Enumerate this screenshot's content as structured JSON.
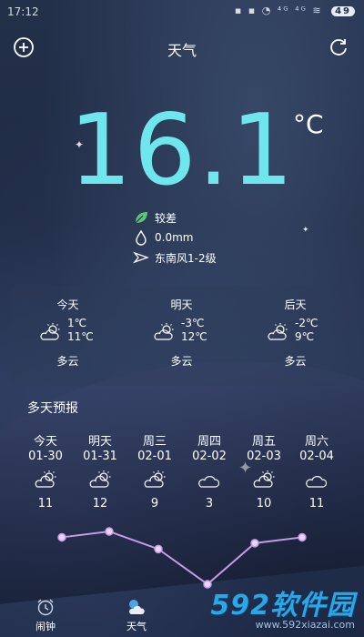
{
  "status_bar": {
    "time": "17:12",
    "icons_text": "▪ ▪ ◔ ⁴ᴳ ⁴ᴳ ≋",
    "battery": "49"
  },
  "header": {
    "title": "天气"
  },
  "current": {
    "temperature": "16.1",
    "unit": "°C",
    "air_quality": "较差",
    "precipitation": "0.0mm",
    "wind": "东南风1-2级"
  },
  "daily_summary": [
    {
      "label": "今天",
      "low": "1℃",
      "high": "11℃",
      "desc": "多云"
    },
    {
      "label": "明天",
      "low": "-3℃",
      "high": "12℃",
      "desc": "多云"
    },
    {
      "label": "后天",
      "low": "-2℃",
      "high": "9℃",
      "desc": "多云"
    }
  ],
  "forecast": {
    "title": "多天预报",
    "days": [
      {
        "name": "今天",
        "date": "01-30",
        "temp": "11",
        "icon": "sun-cloud-icon"
      },
      {
        "name": "明天",
        "date": "01-31",
        "temp": "12",
        "icon": "sun-cloud-icon"
      },
      {
        "name": "周三",
        "date": "02-01",
        "temp": "9",
        "icon": "sun-cloud-icon"
      },
      {
        "name": "周四",
        "date": "02-02",
        "temp": "3",
        "icon": "cloud-icon"
      },
      {
        "name": "周五",
        "date": "02-03",
        "temp": "10",
        "icon": "sun-cloud-icon"
      },
      {
        "name": "周六",
        "date": "02-04",
        "temp": "11",
        "icon": "cloud-icon"
      }
    ]
  },
  "chart_data": {
    "type": "line",
    "x": [
      "01-30",
      "01-31",
      "02-01",
      "02-02",
      "02-03",
      "02-04"
    ],
    "series": [
      {
        "values": [
          11,
          12,
          9,
          3,
          10,
          11
        ]
      }
    ],
    "color": "#c79be8"
  },
  "tabs": [
    {
      "label": "闹钟",
      "icon": "alarm-clock-icon"
    },
    {
      "label": "天气",
      "icon": "weather-icon"
    }
  ],
  "watermark": {
    "text": "592软件园",
    "url": "www.592xiazai.com"
  },
  "colors": {
    "temperature": "#6fe6ec",
    "leaf": "#5ec47a",
    "chart_line": "#c79be8",
    "watermark": "#2aa7e6"
  }
}
